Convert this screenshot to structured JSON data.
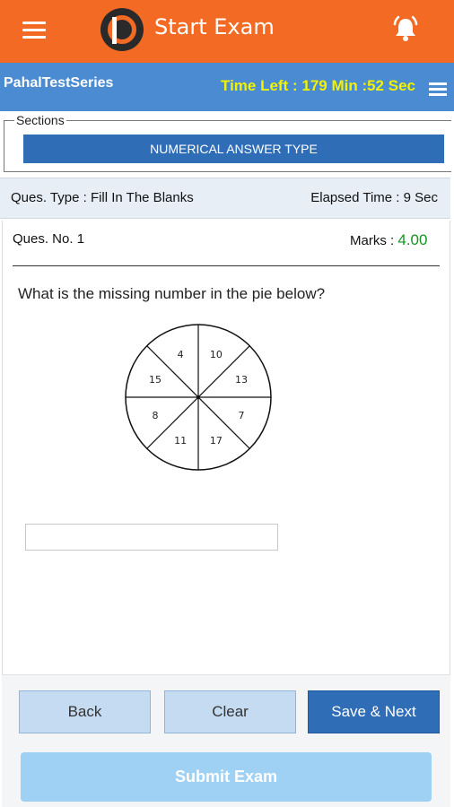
{
  "app_bar": {
    "title": "Start Exam",
    "menu_icon": "hamburger-menu-icon",
    "logo": "pahal-p-logo",
    "bell_icon": "bell-alert-icon",
    "background": "#f26a24"
  },
  "info_bar": {
    "brand": "PahalTestSeries",
    "time_left": "Time Left : 179 Min :52 Sec",
    "menu_icon": "list-menu-icon",
    "background": "#4a8bd1",
    "time_color": "#f2f200"
  },
  "sections": {
    "legend": "Sections",
    "active_section": "NUMERICAL ANSWER TYPE"
  },
  "question_info": {
    "type": "Ques. Type : Fill In The Blanks",
    "elapsed": "Elapsed Time : 9 Sec"
  },
  "question": {
    "number": "Ques. No. 1",
    "marks_label": "Marks : ",
    "marks_value": "4.00",
    "text": "What is the missing number in the pie below?",
    "pie_numbers": [
      "10",
      "13",
      "7",
      "17",
      "11",
      "8",
      "15",
      "4"
    ],
    "answer_value": "",
    "answer_placeholder": ""
  },
  "buttons": {
    "back": "Back",
    "clear": "Clear",
    "save_next": "Save & Next",
    "submit": "Submit Exam"
  },
  "colors": {
    "primary": "#2f6db6",
    "light_button": "#c5dbf2",
    "marks_green": "#14961e",
    "submit_disabled": "#9fd1f5"
  }
}
